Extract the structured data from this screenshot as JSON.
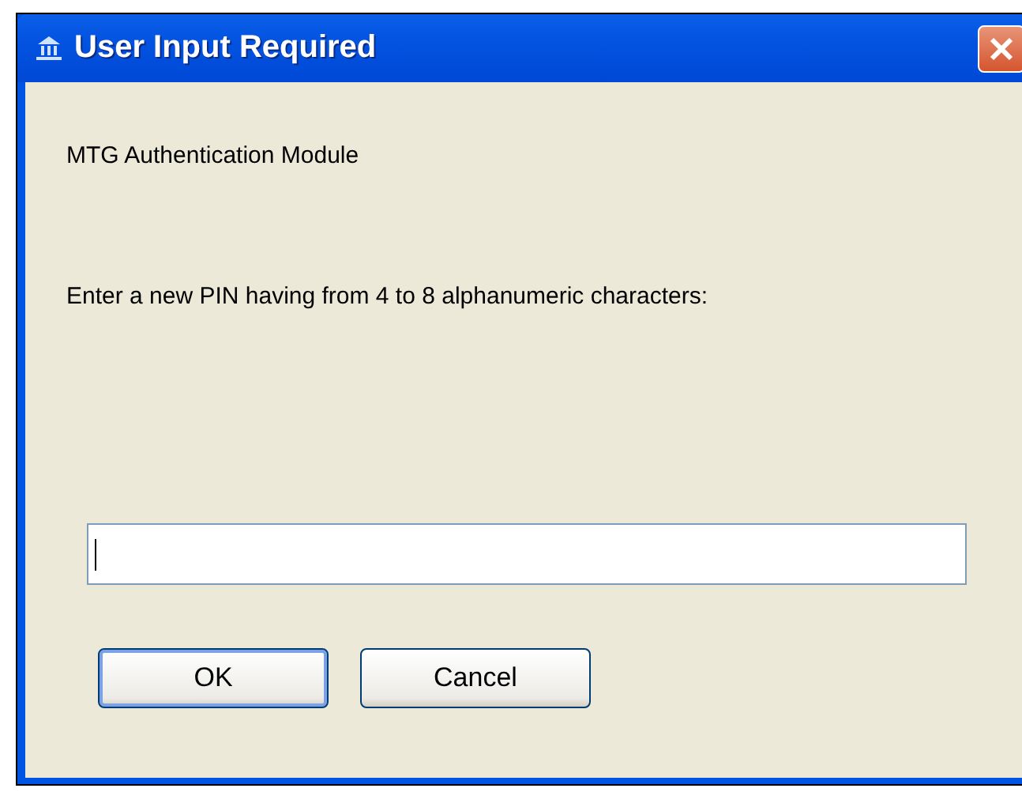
{
  "window": {
    "title": "User Input Required"
  },
  "module_label": "MTG Authentication Module",
  "prompt": "Enter a new PIN having from 4 to 8 alphanumeric characters:",
  "pin_field": {
    "focused": true
  },
  "buttons": [
    {
      "label": "OK",
      "default": true
    },
    {
      "label": "Cancel",
      "default": false
    }
  ]
}
